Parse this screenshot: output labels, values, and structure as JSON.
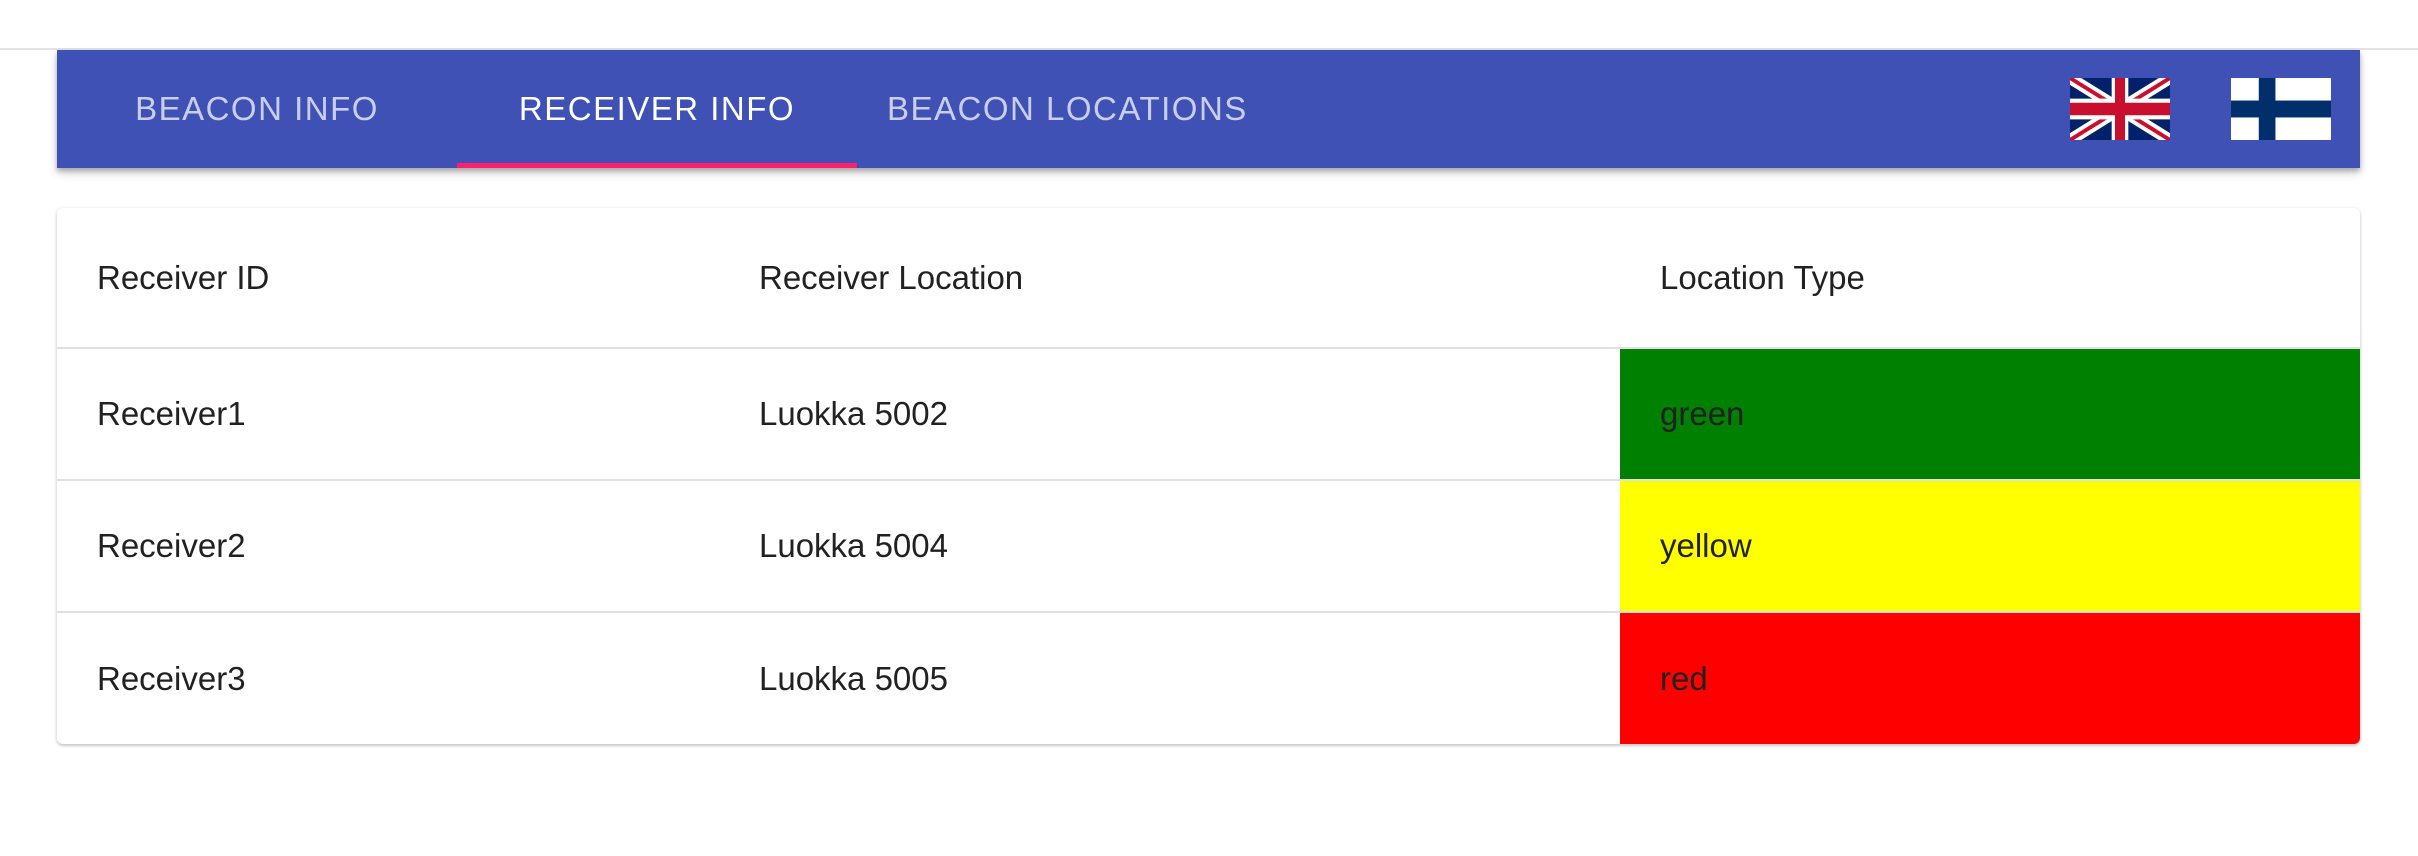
{
  "nav": {
    "tabs": [
      {
        "label": "BEACON INFO",
        "active": false
      },
      {
        "label": "RECEIVER INFO",
        "active": true
      },
      {
        "label": "BEACON LOCATIONS",
        "active": false
      }
    ],
    "flags": [
      {
        "icon": "uk-flag-icon"
      },
      {
        "icon": "finland-flag-icon"
      }
    ],
    "colors": {
      "bar": "#3f51b5",
      "indicator": "#ff1f6b"
    }
  },
  "table": {
    "headers": [
      "Receiver ID",
      "Receiver Location",
      "Location Type"
    ],
    "rows": [
      {
        "id": "Receiver1",
        "location": "Luokka 5002",
        "type": "green",
        "type_color": "#008000"
      },
      {
        "id": "Receiver2",
        "location": "Luokka 5004",
        "type": "yellow",
        "type_color": "#ffff00"
      },
      {
        "id": "Receiver3",
        "location": "Luokka 5005",
        "type": "red",
        "type_color": "#ff0000"
      }
    ]
  }
}
